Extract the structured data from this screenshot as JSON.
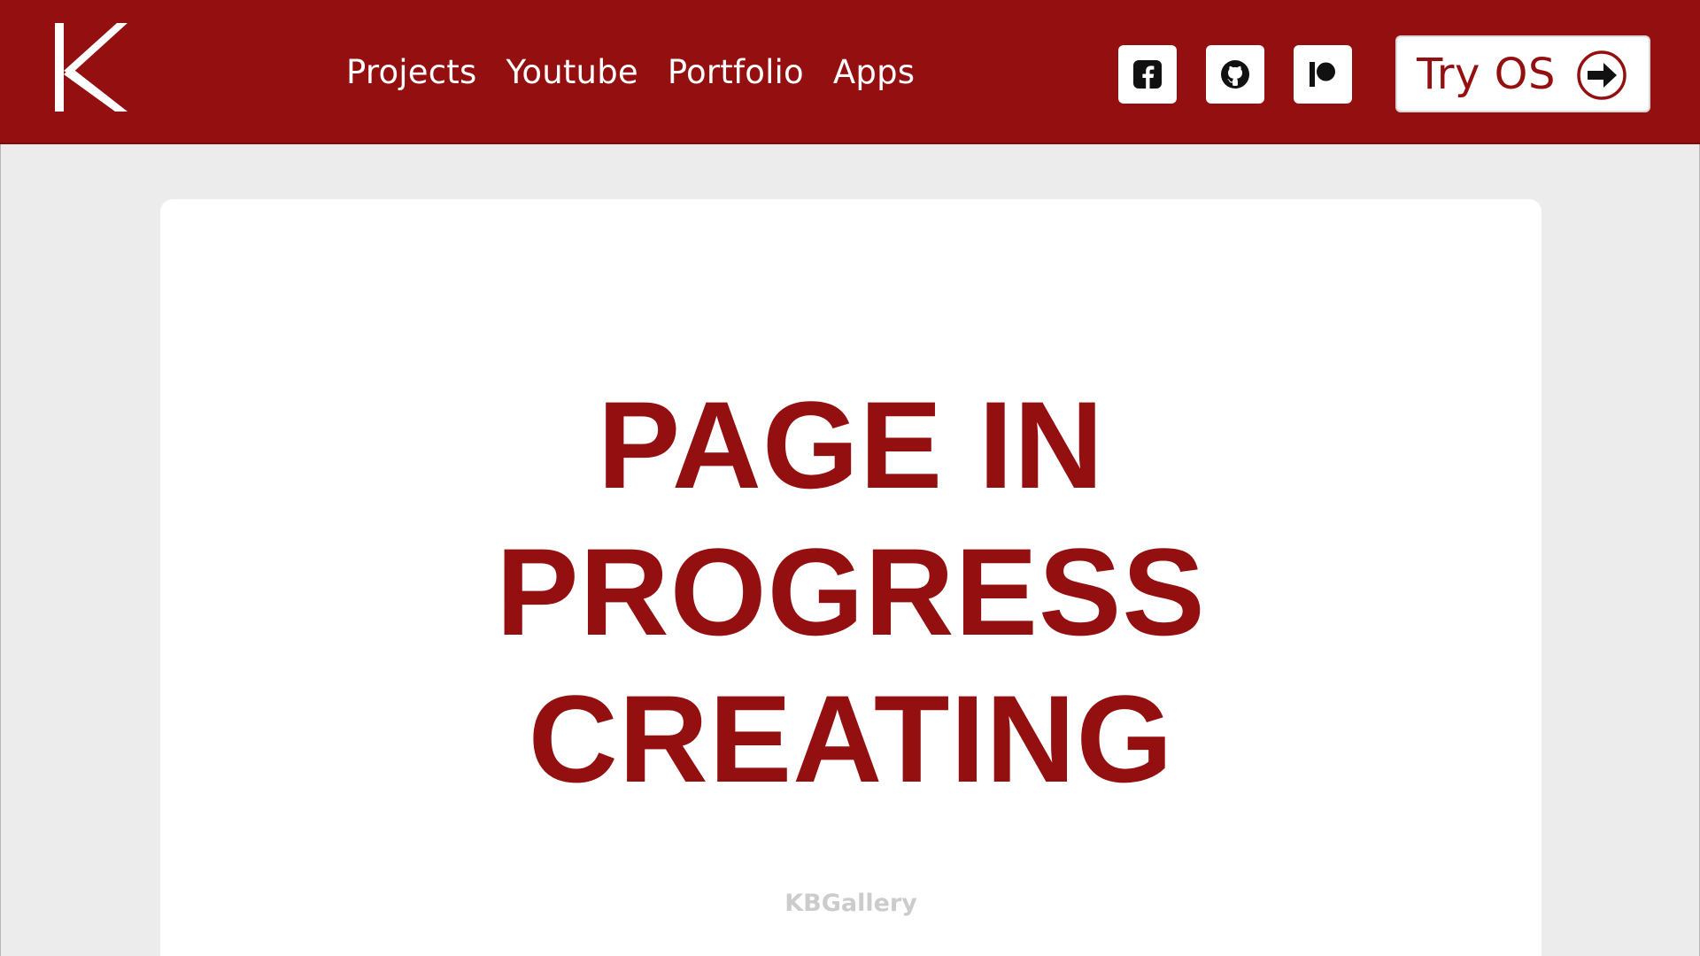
{
  "brand": {
    "logo_letter": "K",
    "logo_icon": "k-logo-icon"
  },
  "nav": {
    "items": [
      {
        "label": "Projects"
      },
      {
        "label": "Youtube"
      },
      {
        "label": "Portfolio"
      },
      {
        "label": "Apps"
      }
    ]
  },
  "social": {
    "items": [
      {
        "name": "facebook",
        "icon": "facebook-icon"
      },
      {
        "name": "github",
        "icon": "github-icon"
      },
      {
        "name": "patreon",
        "icon": "patreon-icon"
      }
    ]
  },
  "cta": {
    "label": "Try OS",
    "icon": "arrow-right-circle-icon"
  },
  "main": {
    "headline_lines": [
      "PAGE IN",
      "PROGRESS",
      "CREATING"
    ],
    "footer_text": "KBGallery"
  },
  "colors": {
    "brand_red": "#940f10",
    "page_bg": "#ececec",
    "card_bg": "#ffffff",
    "muted_text": "#cccccc"
  }
}
